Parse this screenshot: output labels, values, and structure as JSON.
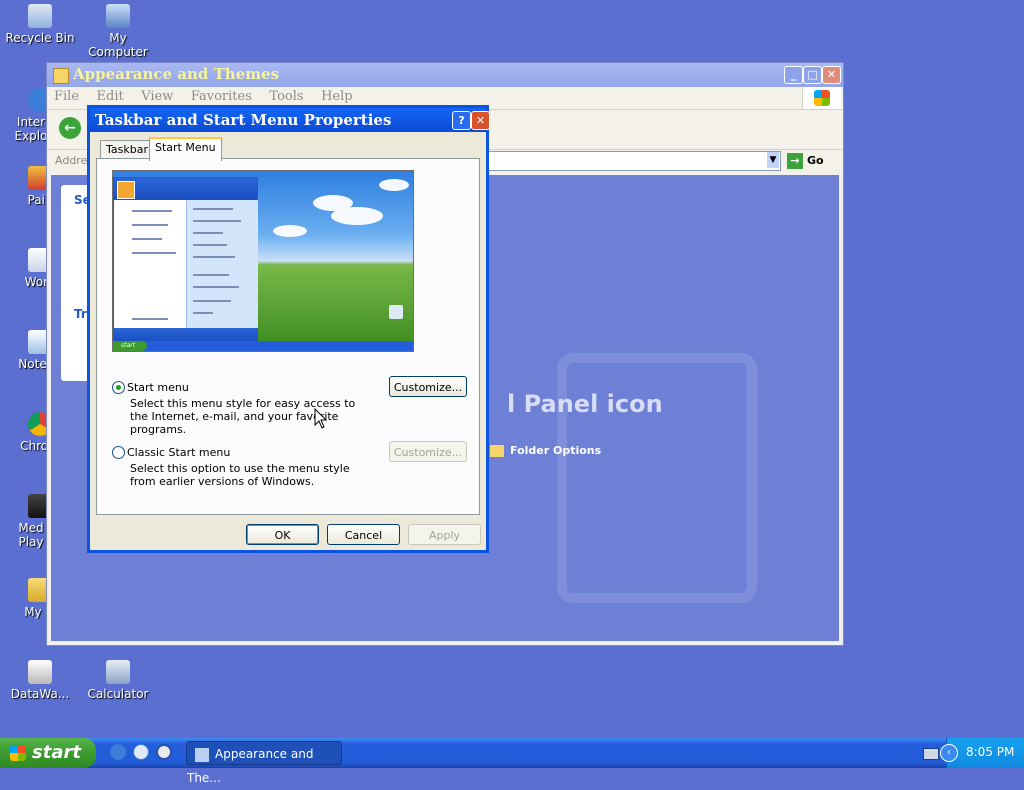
{
  "desktop": {
    "icons": [
      {
        "label": "Recycle Bin",
        "icon": "recycle-bin-icon"
      },
      {
        "label": "My Computer",
        "icon": "my-computer-icon"
      },
      {
        "label": "Inter Explo",
        "icon": "internet-explorer-icon"
      },
      {
        "label": "Pain",
        "icon": "paint-icon"
      },
      {
        "label": "Word",
        "icon": "wordpad-icon"
      },
      {
        "label": "Notepa",
        "icon": "notepad-icon"
      },
      {
        "label": "Chrom",
        "icon": "chrome-icon"
      },
      {
        "label": "Med Play",
        "icon": "media-player-icon"
      },
      {
        "label": "My M",
        "icon": "my-music-icon"
      },
      {
        "label": "DataWa...",
        "icon": "datawarehouse-icon"
      },
      {
        "label": "Calculator",
        "icon": "calculator-icon"
      }
    ]
  },
  "background_window": {
    "title": "Appearance and Themes",
    "menu": [
      "File",
      "Edit",
      "View",
      "Favorites",
      "Tools",
      "Help"
    ],
    "address_label": "Addres",
    "go_label": "Go",
    "panel1_label": "Se",
    "panel2_label": "Tr",
    "big_text": "l Panel icon",
    "folder_options": "Folder Options"
  },
  "dialog": {
    "title": "Taskbar and Start Menu Properties",
    "tabs": [
      "Taskbar",
      "Start Menu"
    ],
    "active_tab": "Start Menu",
    "option_start_menu": {
      "label": "Start menu",
      "selected": true,
      "description": "Select this menu style for easy access to the Internet, e-mail, and your favorite programs.",
      "customize": "Customize..."
    },
    "option_classic": {
      "label": "Classic Start menu",
      "selected": false,
      "description": "Select this option to use the menu style from earlier versions of Windows.",
      "customize": "Customize..."
    },
    "buttons": {
      "ok": "OK",
      "cancel": "Cancel",
      "apply": "Apply"
    },
    "preview": {
      "start_label": "start"
    }
  },
  "taskbar": {
    "start_label": "start",
    "task_item": "Appearance and The...",
    "clock": "8:05 PM"
  },
  "colors": {
    "desktop": "#5a6fd0",
    "taskbar": "#245edc",
    "title_active": "#0b4ad4",
    "start_green": "#3c9a2e"
  }
}
